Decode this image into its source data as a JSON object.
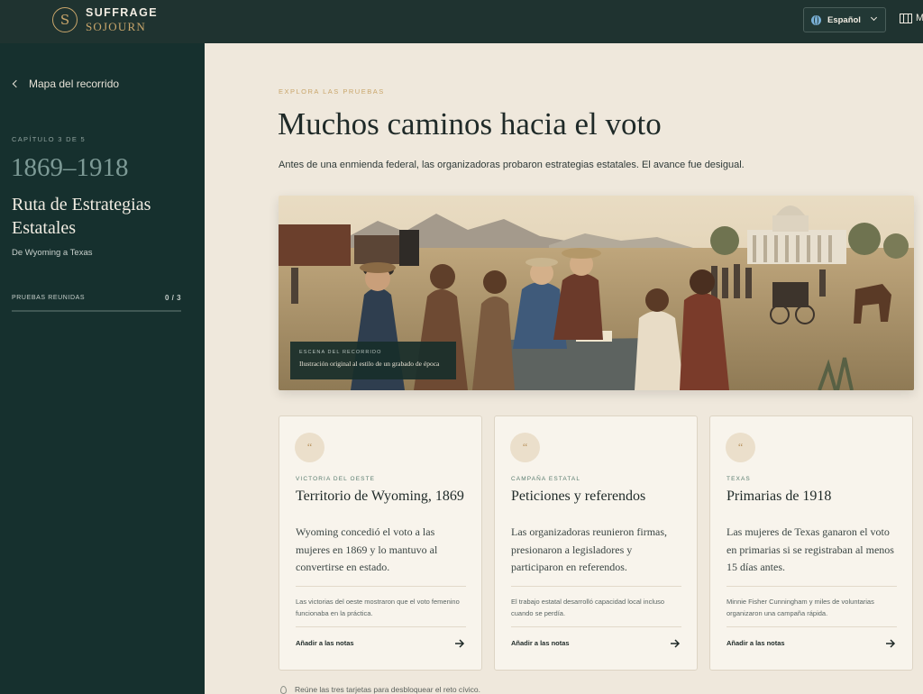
{
  "header": {
    "brand_top": "SUFFRAGE",
    "brand_bottom": "SOJOURN",
    "brand_mark": "S",
    "language": "Español",
    "map_label": "M",
    "colors": {
      "bar": "#1f3330",
      "accent": "#c9a66b"
    }
  },
  "sidebar": {
    "back_label": "Mapa del recorrido",
    "chapter": "CAPÍTULO 3 DE 5",
    "years": "1869–1918",
    "route_title": "Ruta de Estrategias Estatales",
    "route_subtitle": "De Wyoming a Texas",
    "proofs_label": "PRUEBAS REUNIDAS",
    "proofs_count": "0 / 3",
    "proofs_progress": 0
  },
  "main": {
    "eyebrow": "EXPLORA LAS PRUEBAS",
    "headline": "Muchos caminos hacia el voto",
    "intro": "Antes de una enmienda federal, las organizadoras probaron estrategias estatales. El avance fue desigual.",
    "scene": {
      "caption_top": "ESCENA DEL RECORRIDO",
      "caption_bottom": "Ilustración original al estilo de un grabado de época"
    },
    "cards": [
      {
        "quote": "“",
        "tag": "VICTORIA DEL OESTE",
        "title": "Territorio de Wyoming, 1869",
        "body": "Wyoming concedió el voto a las mujeres en 1869 y lo mantuvo al convertirse en estado.",
        "note": "Las victorias del oeste mostraron que el voto femenino funcionaba en la práctica.",
        "action": "Añadir a las notas"
      },
      {
        "quote": "“",
        "tag": "CAMPAÑA ESTATAL",
        "title": "Peticiones y referendos",
        "body": "Las organizadoras reunieron firmas, presionaron a legisladores y participaron en referendos.",
        "note": "El trabajo estatal desarrolló capacidad local incluso cuando se perdía.",
        "action": "Añadir a las notas"
      },
      {
        "quote": "“",
        "tag": "TEXAS",
        "title": "Primarias de 1918",
        "body": "Las mujeres de Texas ganaron el voto en primarias si se registraban al menos 15 días antes.",
        "note": "Minnie Fisher Cunningham y miles de voluntarias organizaron una campaña rápida.",
        "action": "Añadir a las notas"
      }
    ],
    "hint": "Reúne las tres tarjetas para desbloquear el reto cívico."
  }
}
